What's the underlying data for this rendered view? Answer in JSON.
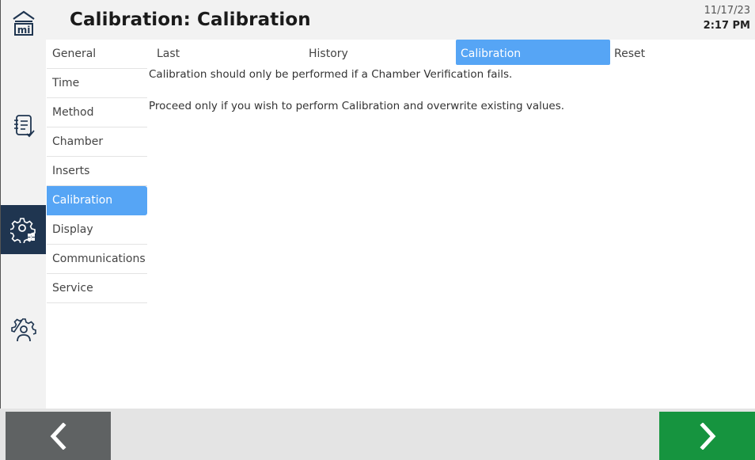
{
  "header": {
    "title": "Calibration: Calibration",
    "date": "11/17/23",
    "time": "2:17 PM"
  },
  "rail": {
    "icons": [
      "home-logo-icon",
      "methods-notebook-icon",
      "settings-gear-icon",
      "service-gear-person-icon"
    ],
    "active": "settings-gear-icon",
    "active_color": "#1f3550"
  },
  "subnav": {
    "items": [
      {
        "label": "General"
      },
      {
        "label": "Time"
      },
      {
        "label": "Method"
      },
      {
        "label": "Chamber"
      },
      {
        "label": "Inserts"
      },
      {
        "label": "Calibration"
      },
      {
        "label": "Display"
      },
      {
        "label": "Communications"
      },
      {
        "label": "Service"
      }
    ],
    "active": "Calibration",
    "accent_color": "#56a5f5"
  },
  "tabs": {
    "items": [
      {
        "label": "Last"
      },
      {
        "label": "History"
      },
      {
        "label": "Calibration"
      },
      {
        "label": "Reset"
      }
    ],
    "active": "Calibration"
  },
  "content": {
    "message_1": "Calibration should only be performed if a Chamber Verification fails.",
    "message_2": "Proceed only if you wish to perform Calibration and overwrite existing values."
  },
  "footer": {
    "back_icon": "chevron-left-icon",
    "next_icon": "chevron-right-icon",
    "back_color": "#5f6263",
    "next_color": "#16943f"
  }
}
